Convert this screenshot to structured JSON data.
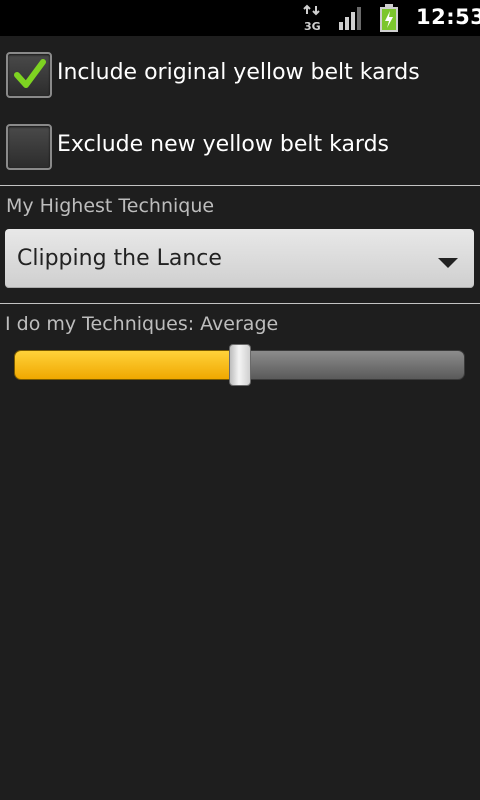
{
  "status_bar": {
    "network_icon": "3g-data-icon",
    "signal_icon": "signal-strength-icon",
    "battery_icon": "battery-charging-icon",
    "time": "12:53"
  },
  "options": {
    "include_original": {
      "label": "Include original yellow belt kards",
      "checked": true
    },
    "exclude_new": {
      "label": "Exclude new yellow belt kards",
      "checked": false
    }
  },
  "highest_technique": {
    "label": "My Highest Technique",
    "selected": "Clipping the Lance"
  },
  "technique_speed": {
    "label": "I do my Techniques: Average",
    "level": 0.5
  },
  "colors": {
    "background": "#1e1e1e",
    "accent_yellow": "#f7b500",
    "check_green": "#7ed321"
  }
}
